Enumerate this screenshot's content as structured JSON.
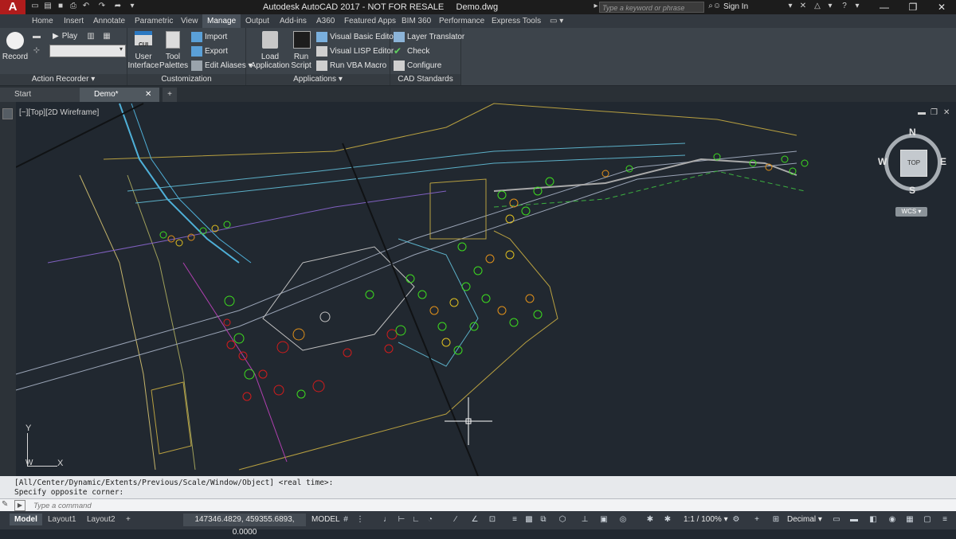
{
  "app": {
    "logo": "A",
    "title": "Autodesk AutoCAD 2017 - NOT FOR RESALE     Demo.dwg",
    "search_placeholder": "Type a keyword or phrase",
    "sign_in": "Sign In"
  },
  "ribbon_tabs": [
    "Home",
    "Insert",
    "Annotate",
    "Parametric",
    "View",
    "Manage",
    "Output",
    "Add-ins",
    "A360",
    "Featured Apps",
    "BIM 360",
    "Performance",
    "Express Tools"
  ],
  "ribbon": {
    "action_recorder": {
      "record": "Record",
      "play": "Play",
      "title": "Action Recorder"
    },
    "customization": {
      "user_interface": "User Interface",
      "cui_badge": "CUI",
      "tool_palettes": "Tool Palettes",
      "import": "Import",
      "export": "Export",
      "edit_aliases": "Edit Aliases",
      "title": "Customization"
    },
    "applications": {
      "load_application": "Load Application",
      "run_script": "Run Script",
      "vba_editor": "Visual Basic Editor",
      "lisp_editor": "Visual LISP Editor",
      "vba_macro": "Run VBA Macro",
      "title": "Applications"
    },
    "cad_standards": {
      "layer_translator": "Layer Translator",
      "check": "Check",
      "configure": "Configure",
      "title": "CAD Standards"
    }
  },
  "file_tabs": [
    "Start",
    "Demo*"
  ],
  "viewport": {
    "label": "[−][Top][2D Wireframe]",
    "viewcube_top": "TOP",
    "compass": {
      "n": "N",
      "s": "S",
      "e": "E",
      "w": "W"
    },
    "wcs": "WCS",
    "ucs_y": "Y",
    "ucs_x": "X",
    "ucs_w": "W"
  },
  "command": {
    "history": [
      "[All/Center/Dynamic/Extents/Previous/Scale/Window/Object] <real time>:",
      "Specify opposite corner:"
    ],
    "placeholder": "Type a command"
  },
  "status": {
    "layout_tabs": [
      "Model",
      "Layout1",
      "Layout2"
    ],
    "coordinates": "147346.4829, 459355.6893, 0.0000",
    "model": "MODEL",
    "scale": "1:1 / 100%",
    "units": "Decimal"
  },
  "colors": {
    "canvas": "#212830",
    "ribbon": "#3d444b",
    "accent_red": "#b01c1c",
    "tree_green": "#3ddc1f",
    "tree_orange": "#e0901a",
    "tree_red": "#d21c1c"
  }
}
